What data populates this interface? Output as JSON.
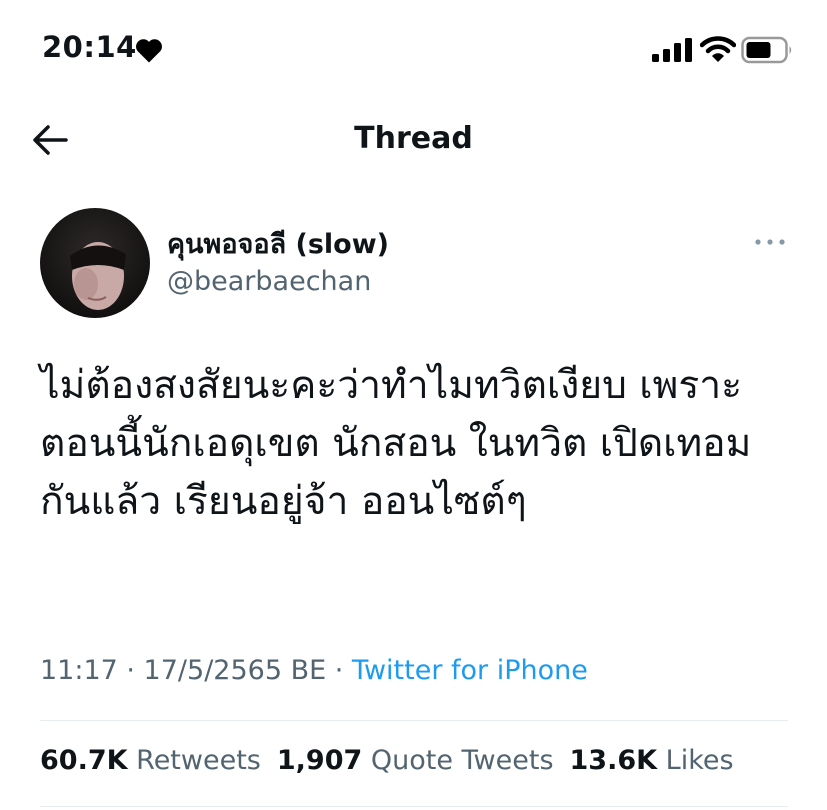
{
  "status_bar": {
    "time": "20:14",
    "icons": [
      "heart-icon",
      "signal-icon",
      "wifi-icon",
      "battery-icon"
    ]
  },
  "header": {
    "title": "Thread",
    "back_icon": "arrow-left-icon"
  },
  "tweet": {
    "display_name": "คุนพอจอลี (slow)",
    "handle": "@bearbaechan",
    "text_lines": [
      "ไม่ต้องสงสัยนะคะว่าทำไมทวิตเงียบ เพราะ",
      "ตอนนี้นักเอดุเขต นักสอน ในทวิต เปิดเทอม",
      "กันแล้ว เรียนอยู่จ้า ออนไซต์ๆ"
    ],
    "timestamp": "11:17 · 17/5/2565 BE · ",
    "source": "Twitter for iPhone",
    "stats": {
      "retweets_count": "60.7K",
      "retweets_label": "Retweets",
      "quotes_count": "1,907",
      "quotes_label": "Quote Tweets",
      "likes_count": "13.6K",
      "likes_label": "Likes"
    }
  },
  "colors": {
    "text": "#0f1419",
    "secondary": "#536471",
    "link": "#1d9bf0",
    "divider": "#e6ecf0"
  }
}
